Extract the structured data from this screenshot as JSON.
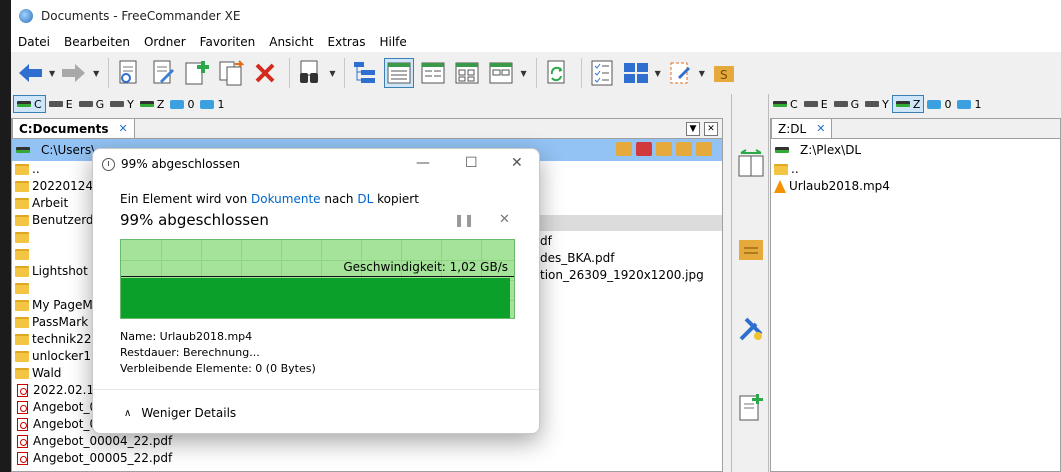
{
  "window": {
    "title": "Documents - FreeCommander XE"
  },
  "menu": [
    "Datei",
    "Bearbeiten",
    "Ordner",
    "Favoriten",
    "Ansicht",
    "Extras",
    "Hilfe"
  ],
  "drives_left": [
    "C",
    "E",
    "G",
    "Y",
    "Z",
    "0",
    "1"
  ],
  "drives_right": [
    "C",
    "E",
    "G",
    "Y",
    "Z",
    "0",
    "1"
  ],
  "left_panel": {
    "tab_label": "C:Documents",
    "path": "C:\\Users\\",
    "files_left": [
      "..",
      "20220124_",
      "Arbeit",
      "Benutzerde",
      "",
      "",
      "Lightshot",
      "",
      "My PageMa",
      "PassMark",
      "technik22",
      "unlocker1.9",
      "Wald",
      "2022.02.10",
      "Angebot_0",
      "Angebot_0",
      "Angebot_00004_22.pdf",
      "Angebot_00005_22.pdf"
    ],
    "files_partial": [
      "df",
      "des_BKA.pdf",
      "tion_26309_1920x1200.jpg"
    ]
  },
  "right_panel": {
    "tab_label": "Z:DL",
    "path": "Z:\\Plex\\DL",
    "files": [
      "..",
      "Urlaub2018.mp4"
    ]
  },
  "dialog": {
    "title": "99% abgeschlossen",
    "copy_prefix": "Ein Element wird von ",
    "source": "Dokumente",
    "copy_mid": " nach ",
    "target": "DL",
    "copy_suffix": " kopiert",
    "percent_text": "99% abgeschlossen",
    "progress": 0.99,
    "speed": "Geschwindigkeit: 1,02 GB/s",
    "name_line": "Name:  Urlaub2018.mp4",
    "remaining_time": "Restdauer:  Berechnung...",
    "remaining_items": "Verbleibende Elemente:  0 (0 Bytes)",
    "less_details": "Weniger Details"
  },
  "colors": {
    "accent": "#93c3f4",
    "graph_fill": "#0aa02a",
    "graph_bg": "#a6e39a"
  }
}
